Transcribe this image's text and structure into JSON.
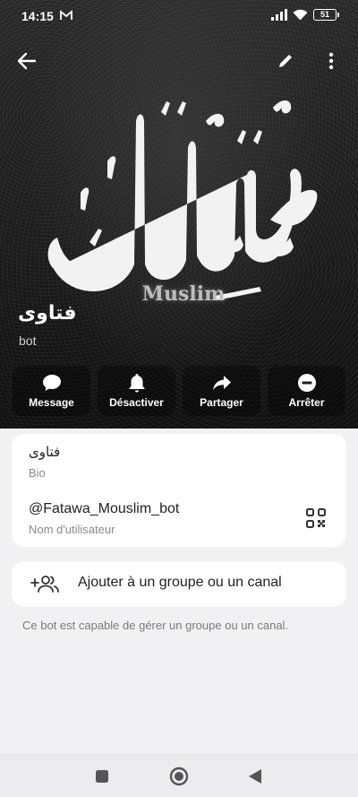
{
  "status_bar": {
    "time": "14:15",
    "battery": "51"
  },
  "profile": {
    "name": "فتاوى",
    "subtitle": "bot",
    "calligraphy_caption": "Muslim"
  },
  "actions": [
    {
      "label": "Message",
      "icon": "message-bubble-icon"
    },
    {
      "label": "Désactiver",
      "icon": "bell-icon"
    },
    {
      "label": "Partager",
      "icon": "share-arrow-icon"
    },
    {
      "label": "Arrêter",
      "icon": "stop-circle-icon"
    }
  ],
  "info": {
    "bio_value": "فتاوى",
    "bio_label": "Bio",
    "username_value": "@Fatawa_Mouslim_bot",
    "username_label": "Nom d'utilisateur"
  },
  "add_to_group": {
    "label": "Ajouter à un groupe ou un canal"
  },
  "hint": "Ce bot est capable de gérer un groupe ou un canal.",
  "colors": {
    "header_bg": "#1e1e1e",
    "page_bg": "#f1f1f4",
    "card_bg": "#ffffff",
    "secondary_text": "#8a8a8a"
  }
}
